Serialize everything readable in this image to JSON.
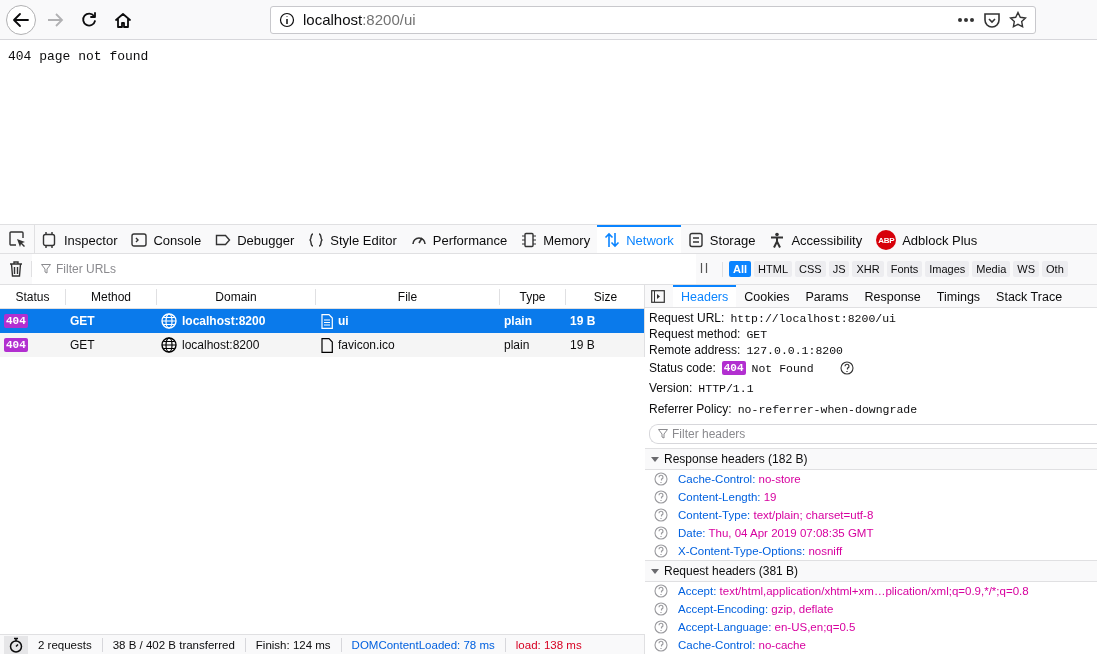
{
  "browser": {
    "url_host": "localhost",
    "url_rest": ":8200/ui"
  },
  "page": {
    "text": "404 page not found"
  },
  "devtools": {
    "tabs": [
      {
        "label": "Inspector",
        "selected": false
      },
      {
        "label": "Console",
        "selected": false
      },
      {
        "label": "Debugger",
        "selected": false
      },
      {
        "label": "Style Editor",
        "selected": false
      },
      {
        "label": "Performance",
        "selected": false
      },
      {
        "label": "Memory",
        "selected": false
      },
      {
        "label": "Network",
        "selected": true
      },
      {
        "label": "Storage",
        "selected": false
      },
      {
        "label": "Accessibility",
        "selected": false
      },
      {
        "label": "Adblock Plus",
        "selected": false,
        "badge": "ABP"
      }
    ],
    "filter": {
      "placeholder": "Filter URLs"
    },
    "type_filters": [
      {
        "label": "All",
        "selected": true
      },
      {
        "label": "HTML",
        "selected": false
      },
      {
        "label": "CSS",
        "selected": false
      },
      {
        "label": "JS",
        "selected": false
      },
      {
        "label": "XHR",
        "selected": false
      },
      {
        "label": "Fonts",
        "selected": false
      },
      {
        "label": "Images",
        "selected": false
      },
      {
        "label": "Media",
        "selected": false
      },
      {
        "label": "WS",
        "selected": false
      },
      {
        "label": "Oth",
        "selected": false
      }
    ]
  },
  "requests": {
    "columns": [
      "Status",
      "Method",
      "Domain",
      "File",
      "Type",
      "Size"
    ],
    "rows": [
      {
        "status": "404",
        "method": "GET",
        "domain": "localhost:8200",
        "file": "ui",
        "kind": "text",
        "type": "plain",
        "size": "19 B",
        "selected": true
      },
      {
        "status": "404",
        "method": "GET",
        "domain": "localhost:8200",
        "file": "favicon.ico",
        "kind": "empty",
        "type": "plain",
        "size": "19 B",
        "selected": false
      }
    ]
  },
  "details": {
    "tabs": [
      {
        "label": "Headers",
        "selected": true
      },
      {
        "label": "Cookies",
        "selected": false
      },
      {
        "label": "Params",
        "selected": false
      },
      {
        "label": "Response",
        "selected": false
      },
      {
        "label": "Timings",
        "selected": false
      },
      {
        "label": "Stack Trace",
        "selected": false
      }
    ],
    "summary": [
      {
        "kind": "text",
        "label": "Request URL:",
        "value": "http://localhost:8200/ui"
      },
      {
        "kind": "text",
        "label": "Request method:",
        "value": "GET"
      },
      {
        "kind": "text",
        "label": "Remote address:",
        "value": "127.0.0.1:8200"
      },
      {
        "kind": "status",
        "label": "Status code:",
        "code": "404",
        "value": "Not Found"
      },
      {
        "kind": "text",
        "label": "Version:",
        "value": "HTTP/1.1"
      },
      {
        "kind": "text",
        "label": "Referrer Policy:",
        "value": "no-referrer-when-downgrade"
      }
    ],
    "filter": {
      "placeholder": "Filter headers"
    },
    "sections": [
      {
        "title": "Response headers (182 B)",
        "expanded": true,
        "headers": [
          {
            "name": "Cache-Control:",
            "value": "no-store"
          },
          {
            "name": "Content-Length:",
            "value": "19"
          },
          {
            "name": "Content-Type:",
            "value": "text/plain; charset=utf-8"
          },
          {
            "name": "Date:",
            "value": "Thu, 04 Apr 2019 07:08:35 GMT"
          },
          {
            "name": "X-Content-Type-Options:",
            "value": "nosniff"
          }
        ]
      },
      {
        "title": "Request headers (381 B)",
        "expanded": true,
        "headers": [
          {
            "name": "Accept:",
            "value": "text/html,application/xhtml+xm…plication/xml;q=0.9,*/*;q=0.8"
          },
          {
            "name": "Accept-Encoding:",
            "value": "gzip, deflate"
          },
          {
            "name": "Accept-Language:",
            "value": "en-US,en;q=0.5"
          },
          {
            "name": "Cache-Control:",
            "value": "no-cache"
          }
        ]
      }
    ]
  },
  "status_bar": [
    {
      "text": "2 requests",
      "color": "#0c0c0d"
    },
    {
      "text": "38 B / 402 B transferred",
      "color": "#0c0c0d"
    },
    {
      "text": "Finish: 124 ms",
      "color": "#0c0c0d"
    },
    {
      "text": "DOMContentLoaded: 78 ms",
      "color": "#0060df"
    },
    {
      "text": "load: 138 ms",
      "color": "#d70022"
    }
  ]
}
